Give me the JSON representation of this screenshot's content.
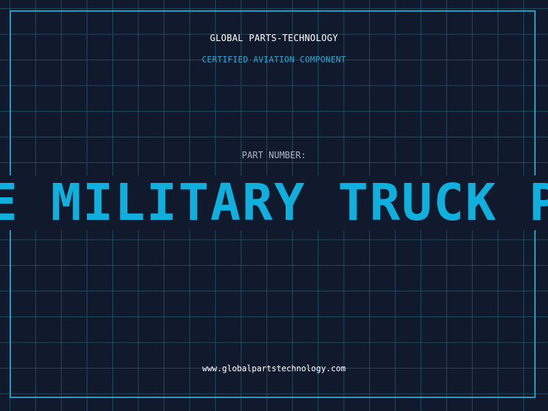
{
  "header": {
    "company": "GLOBAL PARTS-TECHNOLOGY",
    "tagline": "CERTIFIED AVIATION COMPONENT"
  },
  "part": {
    "label": "PART NUMBER:",
    "value": "E MILITARY TRUCK P"
  },
  "footer": {
    "website": "www.globalpartstechnology.com"
  },
  "colors": {
    "background": "#111a2c",
    "grid": "#1d4d63",
    "frame": "#1fa3c8",
    "accent": "#0fb0de"
  }
}
